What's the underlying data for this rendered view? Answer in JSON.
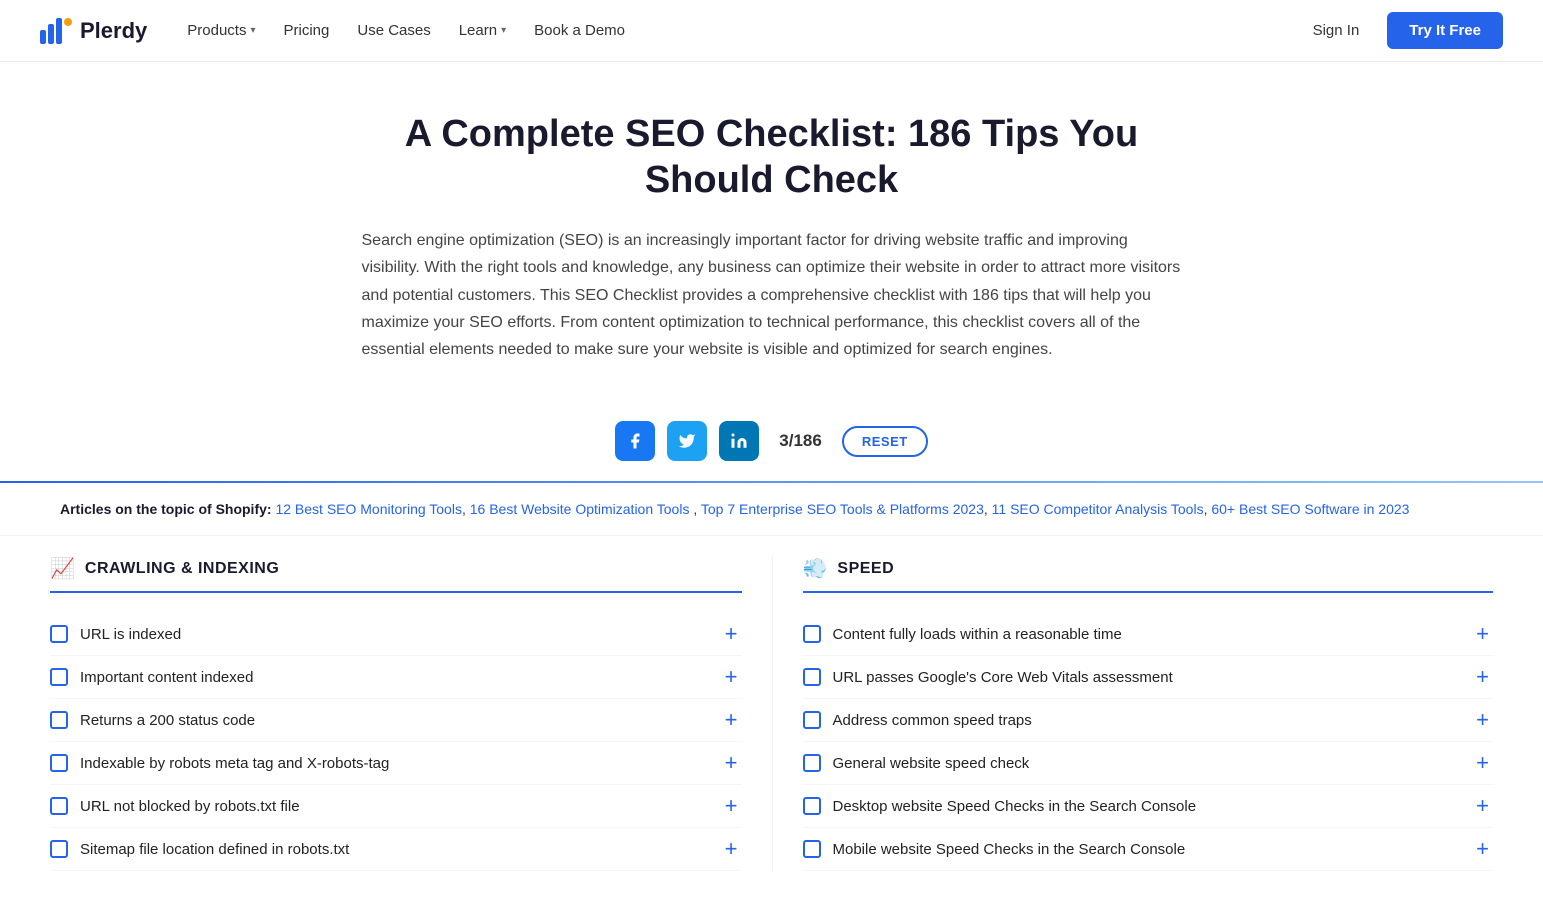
{
  "navbar": {
    "logo_text": "Plerdy",
    "nav_items": [
      {
        "label": "Products",
        "has_chevron": true
      },
      {
        "label": "Pricing",
        "has_chevron": false
      },
      {
        "label": "Use Cases",
        "has_chevron": false
      },
      {
        "label": "Learn",
        "has_chevron": true
      },
      {
        "label": "Book a Demo",
        "has_chevron": false
      }
    ],
    "sign_in": "Sign In",
    "try_free": "Try It Free"
  },
  "hero": {
    "title": "A Complete SEO Checklist: 186 Tips You Should Check",
    "description": "Search engine optimization (SEO) is an increasingly important factor for driving website traffic and improving visibility. With the right tools and knowledge, any business can optimize their website in order to attract more visitors and potential customers. This SEO Checklist provides a comprehensive checklist with 186 tips that will help you maximize your SEO efforts. From content optimization to technical performance, this checklist covers all of the essential elements needed to make sure your website is visible and optimized for search engines."
  },
  "social": {
    "counter": "3/186",
    "reset_label": "RESET"
  },
  "articles": {
    "prefix": "Articles on the topic of Shopify:",
    "links": [
      "12 Best SEO Monitoring Tools",
      "16 Best Website Optimization Tools",
      "Top 7 Enterprise SEO Tools & Platforms 2023",
      "11 SEO Competitor Analysis Tools",
      "60+ Best SEO Software in 2023"
    ]
  },
  "crawling_section": {
    "icon": "📈",
    "title": "CRAWLING & INDEXING",
    "items": [
      "URL is indexed",
      "Important content indexed",
      "Returns a 200 status code",
      "Indexable by robots meta tag and X-robots-tag",
      "URL not blocked by robots.txt file",
      "Sitemap file location defined in robots.txt"
    ]
  },
  "speed_section": {
    "icon": "💨",
    "title": "SPEED",
    "items": [
      "Content fully loads within a reasonable time",
      "URL passes Google's Core Web Vitals assessment",
      "Address common speed traps",
      "General website speed check",
      "Desktop website Speed Checks in the Search Console",
      "Mobile website Speed Checks in the Search Console"
    ]
  }
}
